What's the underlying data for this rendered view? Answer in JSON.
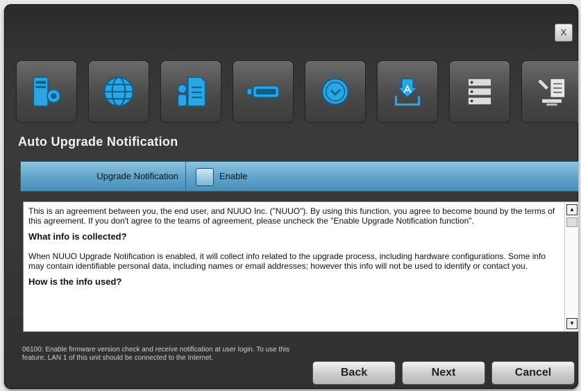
{
  "window": {
    "close_label": "X"
  },
  "toolbar": {
    "icons": [
      {
        "name": "server-camera-icon"
      },
      {
        "name": "globe-icon"
      },
      {
        "name": "user-document-icon"
      },
      {
        "name": "storage-drive-icon"
      },
      {
        "name": "clock-icon"
      },
      {
        "name": "upgrade-download-icon"
      },
      {
        "name": "server-list-icon"
      },
      {
        "name": "tools-icon"
      }
    ]
  },
  "section": {
    "title": "Auto Upgrade Notification"
  },
  "setting": {
    "label": "Upgrade Notification",
    "checkbox_label": "Enable",
    "checked": false
  },
  "agreement": {
    "intro": "This is an agreement between you, the end user, and NUUO Inc. (\"NUUO\"). By using this function, you agree to become bound by the terms of this agreement. If you don't agree to the teams of agreement, please uncheck the \"Enable Upgrade Notification function\".",
    "heading1": "What info is collected?",
    "body1": "When NUUO Upgrade Notification is enabled, it will collect info related to the upgrade process, including hardware configurations. Some info may contain identifiable personal data, including names or email addresses; however this info will not be used to identify or contact you.",
    "heading2": "How is the info used?"
  },
  "footer": {
    "note": "06100: Enable firmware version check and receive notification at user login. To use this feature, LAN 1 of this unit should be connected to the Internet.",
    "back_label": "Back",
    "next_label": "Next",
    "cancel_label": "Cancel"
  },
  "colors": {
    "accent": "#29a3e0",
    "bar": "#5ea3c9"
  }
}
